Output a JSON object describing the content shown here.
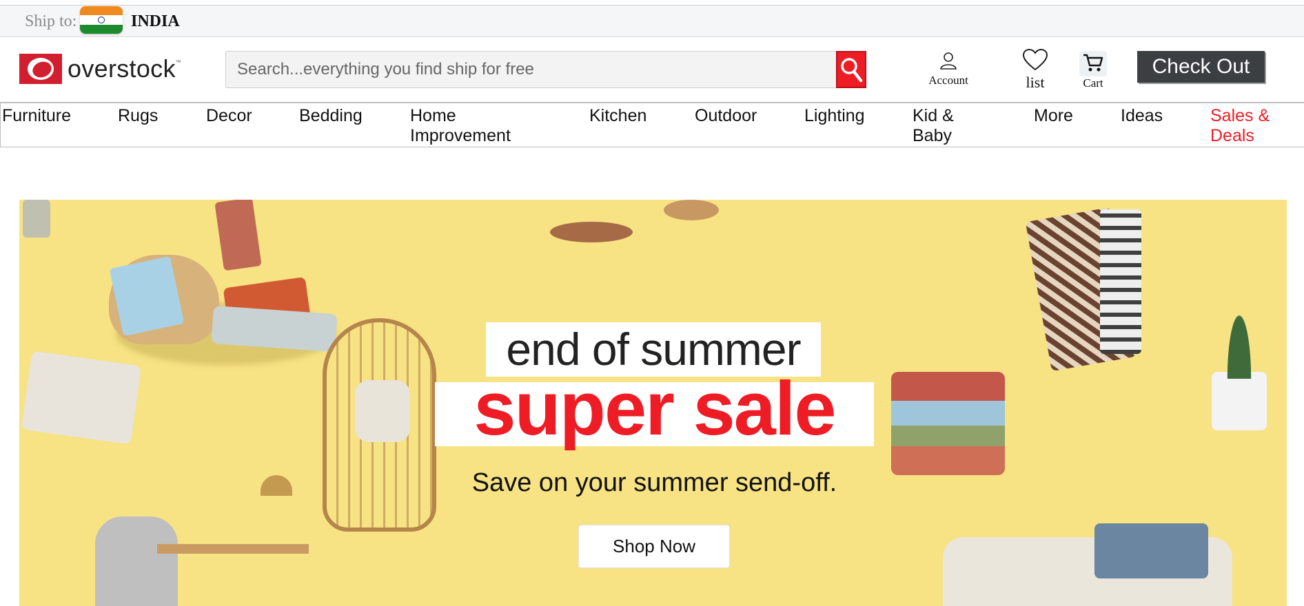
{
  "ship_bar": {
    "label": "Ship to:",
    "country": "INDIA",
    "flag_icon": "india-flag-icon"
  },
  "header": {
    "logo_text": "overstock",
    "logo_tm": "™",
    "search_placeholder": "Search...everything you find ship for free",
    "account_label": "Account",
    "list_label": "list",
    "cart_label": "Cart",
    "checkout_label": "Check Out"
  },
  "nav": {
    "items": [
      {
        "label": "Furniture"
      },
      {
        "label": "Rugs"
      },
      {
        "label": "Decor"
      },
      {
        "label": "Bedding"
      },
      {
        "label": "Home Improvement"
      },
      {
        "label": "Kitchen"
      },
      {
        "label": "Outdoor"
      },
      {
        "label": "Lighting"
      },
      {
        "label": "Kid & Baby"
      },
      {
        "label": "More"
      },
      {
        "label": "Ideas"
      },
      {
        "label": "Sales & Deals"
      }
    ]
  },
  "hero": {
    "heading_line1": "end of summer",
    "heading_line2": "super sale",
    "subheading": "Save on your summer send-off.",
    "cta_label": "Shop Now"
  },
  "colors": {
    "brand_red": "#ee1c24",
    "hero_bg": "#f7e284",
    "checkout_bg": "#3b3f42",
    "sales_link": "#ee1c24"
  }
}
